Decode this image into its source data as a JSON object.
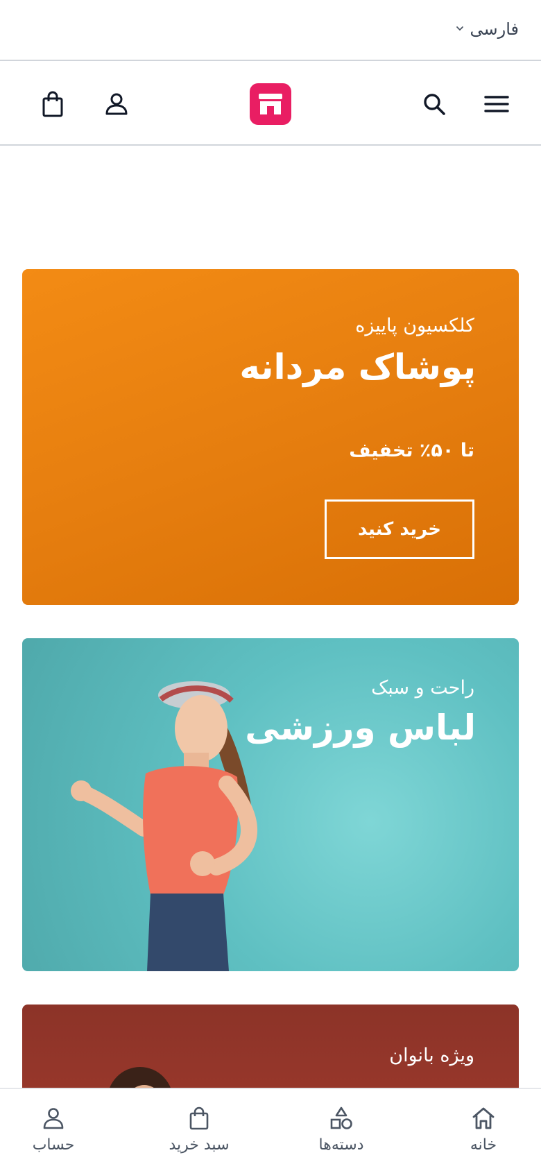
{
  "language_selector": {
    "label": "فارسی"
  },
  "header": {
    "menu_icon": "menu-icon",
    "search_icon": "search-icon",
    "logo_icon": "store-logo-icon",
    "account_icon": "user-icon",
    "bag_icon": "shopping-bag-icon"
  },
  "banners": [
    {
      "subtitle": "کلکسیون پاییزه",
      "title": "پوشاک مردانه",
      "discount": "تا ۵۰٪ تخفیف",
      "button": "خرید کنید",
      "color": "#ef8512"
    },
    {
      "subtitle": "راحت و سبک",
      "title": "لباس ورزشی",
      "color": "#6ccaca"
    },
    {
      "subtitle": "ویژه بانوان",
      "color": "#983829"
    }
  ],
  "bottom_nav": {
    "items": [
      {
        "label": "خانه",
        "icon": "home-icon"
      },
      {
        "label": "دسته‌ها",
        "icon": "categories-icon"
      },
      {
        "label": "سبد خرید",
        "icon": "shopping-bag-icon"
      },
      {
        "label": "حساب",
        "icon": "user-icon"
      }
    ]
  },
  "colors": {
    "brand": "#e91e63",
    "text": "#111827",
    "muted": "#4b5563"
  }
}
